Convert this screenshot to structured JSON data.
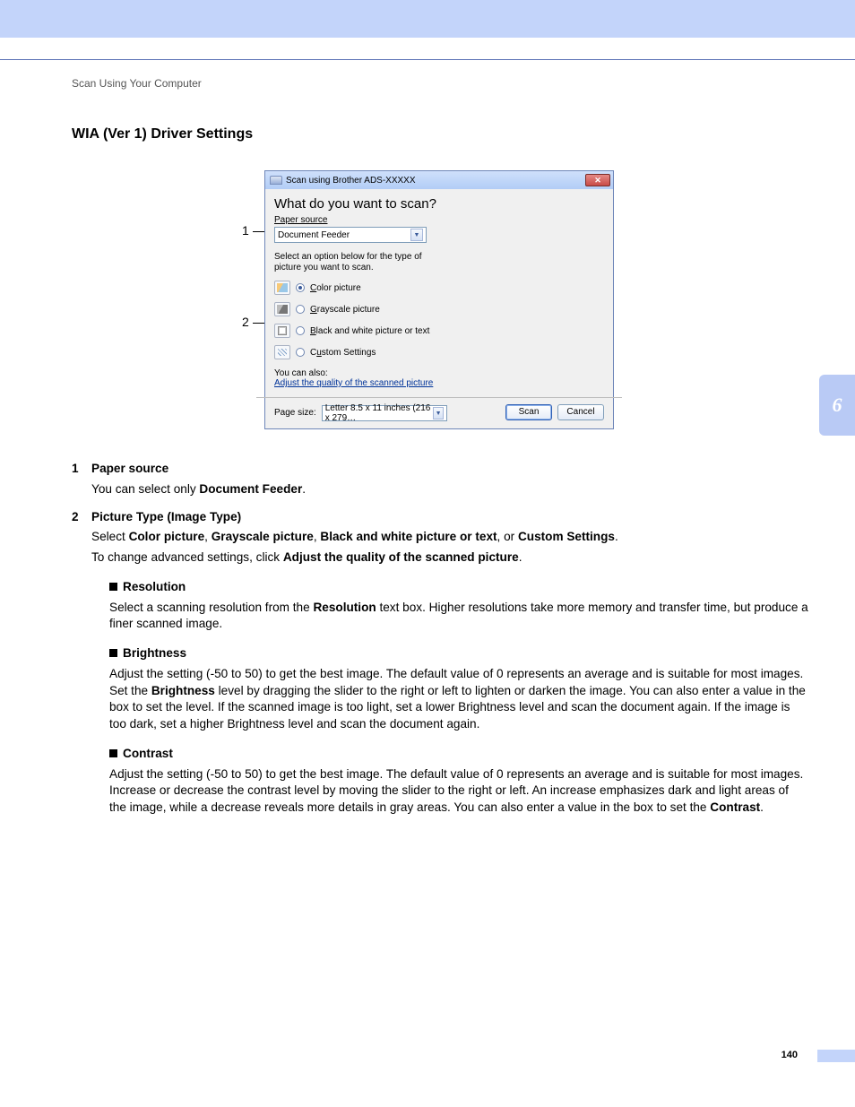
{
  "header": {
    "breadcrumb": "Scan Using Your Computer",
    "chapter_number": "6"
  },
  "page": {
    "heading": "WIA (Ver 1) Driver Settings",
    "number": "140"
  },
  "callouts": {
    "c1": "1",
    "c2": "2"
  },
  "dialog": {
    "title": "Scan using Brother ADS-XXXXX",
    "heading": "What do you want to scan?",
    "paper_source_label": "Paper source",
    "paper_source_value": "Document Feeder",
    "instruction": "Select an option below for the type of picture you want to scan.",
    "options": {
      "color": "Color picture",
      "grayscale": "Grayscale picture",
      "bw": "Black and white picture or text",
      "custom": "Custom Settings"
    },
    "you_can_also": "You can also:",
    "adjust_link": "Adjust the quality of the scanned picture",
    "page_size_label": "Page size:",
    "page_size_value": "Letter 8.5 x 11 inches (216 x 279…",
    "scan_btn": "Scan",
    "cancel_btn": "Cancel"
  },
  "body": {
    "item1": {
      "num": "1",
      "label": "Paper source",
      "line1_a": "You can select only ",
      "line1_b": "Document Feeder",
      "line1_c": "."
    },
    "item2": {
      "num": "2",
      "label": "Picture Type (Image Type)",
      "l1_a": "Select ",
      "l1_b": "Color picture",
      "l1_c": ", ",
      "l1_d": "Grayscale picture",
      "l1_e": ", ",
      "l1_f": "Black and white picture or text",
      "l1_g": ", or ",
      "l1_h": "Custom Settings",
      "l1_i": ".",
      "l2_a": "To change advanced settings, click ",
      "l2_b": "Adjust the quality of the scanned picture",
      "l2_c": "."
    },
    "res": {
      "label": "Resolution",
      "t1": "Select a scanning resolution from the ",
      "t2": "Resolution",
      "t3": " text box. Higher resolutions take more memory and transfer time, but produce a finer scanned image."
    },
    "bri": {
      "label": "Brightness",
      "t1": "Adjust the setting (-50 to 50) to get the best image. The default value of 0 represents an average and is suitable for most images. Set the ",
      "t2": "Brightness",
      "t3": " level by dragging the slider to the right or left to lighten or darken the image. You can also enter a value in the box to set the level. If the scanned image is too light, set a lower Brightness level and scan the document again. If the image is too dark, set a higher Brightness level and scan the document again."
    },
    "con": {
      "label": "Contrast",
      "t1": "Adjust the setting (-50 to 50) to get the best image. The default value of 0 represents an average and is suitable for most images. Increase or decrease the contrast level by moving the slider to the right or left. An increase emphasizes dark and light areas of the image, while a decrease reveals more details in gray areas. You can also enter a value in the box to set the ",
      "t2": "Contrast",
      "t3": "."
    }
  }
}
